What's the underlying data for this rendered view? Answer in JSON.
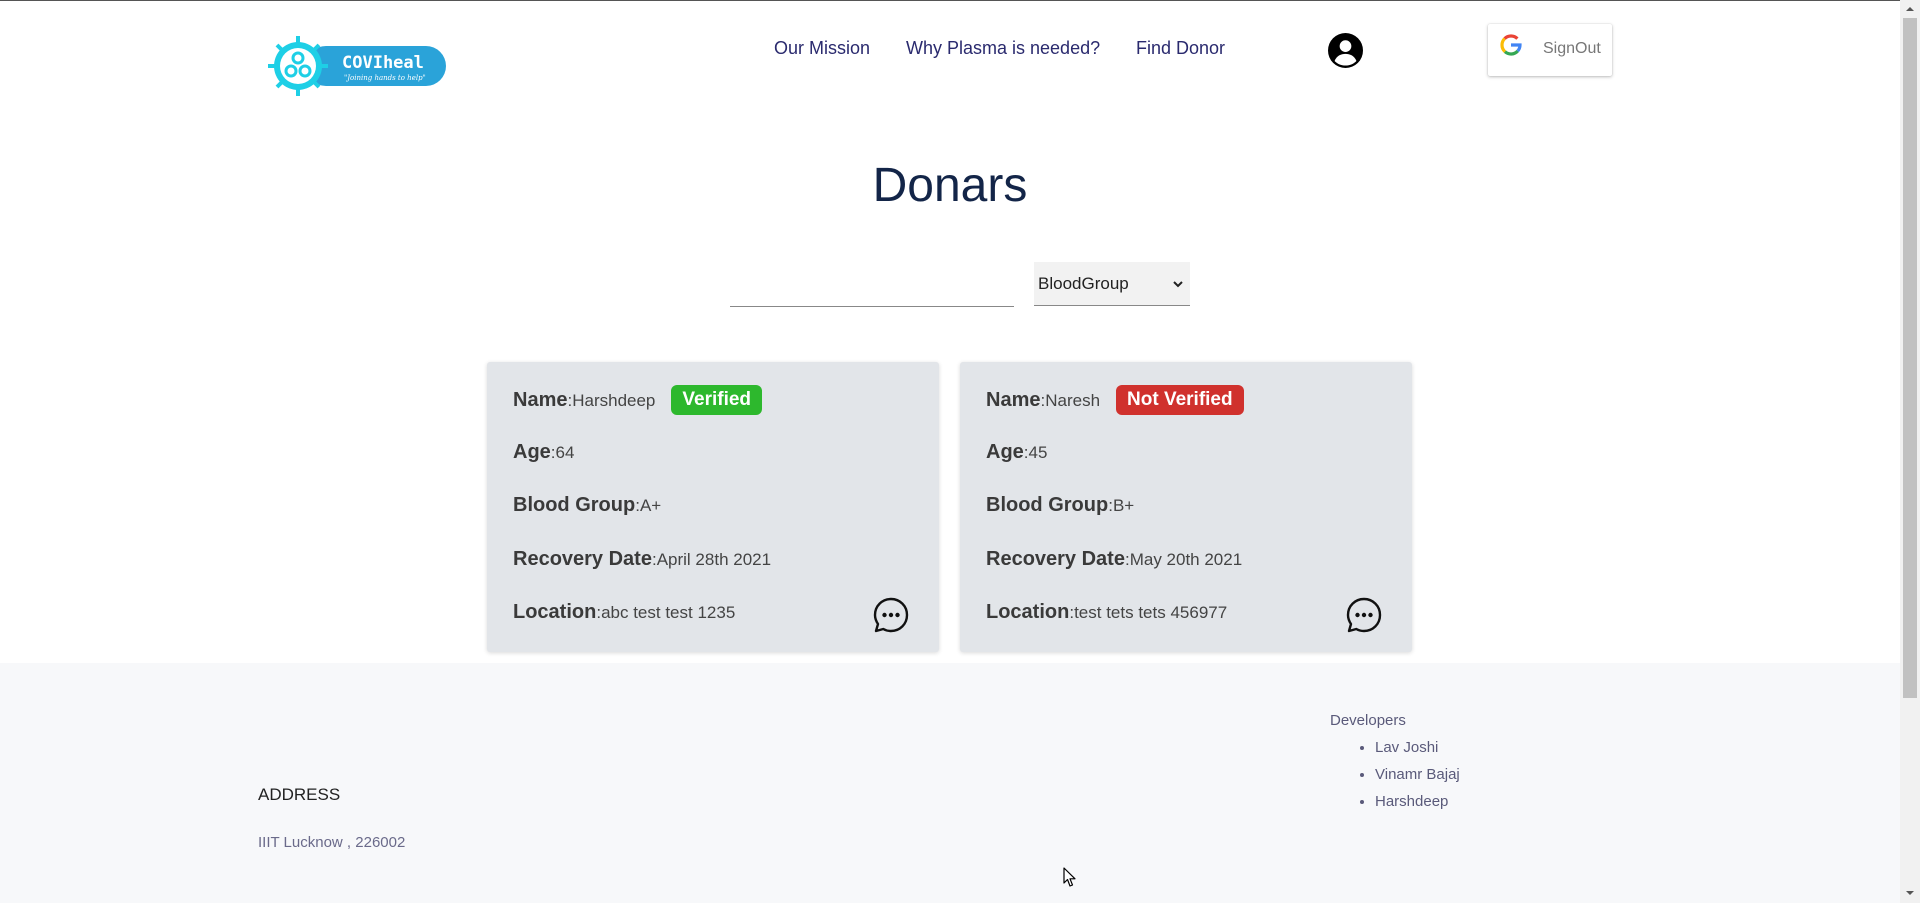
{
  "header": {
    "logo": {
      "title": "COVIheal",
      "tagline": "\"Joining hands to help\""
    },
    "nav": [
      {
        "label": "Our Mission"
      },
      {
        "label": "Why Plasma is needed?"
      },
      {
        "label": "Find Donor"
      }
    ],
    "account_icon": "account-circle-icon",
    "signout": {
      "label": "SignOut",
      "icon": "google-icon"
    }
  },
  "main": {
    "title": "Donars",
    "search": {
      "value": "",
      "placeholder": ""
    },
    "blood_group_select": {
      "selected": "BloodGroup",
      "icon": "chevron-down-icon"
    }
  },
  "labels": {
    "name": "Name",
    "age": "Age",
    "blood_group": "Blood Group",
    "recovery_date": "Recovery Date",
    "location": "Location",
    "separator": ":"
  },
  "donors": [
    {
      "name": "Harshdeep",
      "status": "Verified",
      "status_color": "#2db82d",
      "age": "64",
      "blood_group": "A+",
      "recovery_date": "April 28th 2021",
      "location": "abc test test 1235",
      "chat_icon": "chat-bubble-icon"
    },
    {
      "name": "Naresh",
      "status": "Not Verified",
      "status_color": "#d0312d",
      "age": "45",
      "blood_group": "B+",
      "recovery_date": "May 20th 2021",
      "location": "test tets tets 456977",
      "chat_icon": "chat-bubble-icon"
    }
  ],
  "footer": {
    "address_heading": "ADDRESS",
    "address": "IIIT Lucknow , 226002",
    "developers_heading": "Developers",
    "developers": [
      "Lav Joshi",
      "Vinamr Bajaj",
      "Harshdeep"
    ]
  },
  "colors": {
    "title": "#132548",
    "nav": "#2a2a6e",
    "card_bg": "#e2e5e9",
    "footer_bg": "#f7f8fa",
    "logo_cyan": "#1ecfe6",
    "logo_blue": "#2aa3d9"
  }
}
